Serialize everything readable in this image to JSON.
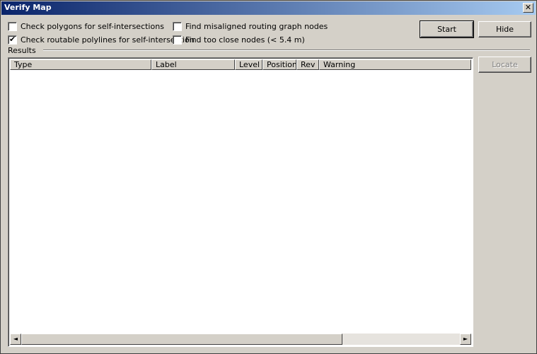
{
  "window": {
    "title": "Verify Map"
  },
  "close_icon": "✕",
  "options": {
    "check_polygons": {
      "label": "Check polygons for self-intersections",
      "checked": false
    },
    "check_polylines": {
      "label": "Check routable polylines for self-intersection",
      "checked": true
    },
    "find_misaligned": {
      "label": "Find misaligned routing graph nodes",
      "checked": false
    },
    "find_close_nodes": {
      "label": "Find too close nodes (< 5.4 m)",
      "checked": false
    }
  },
  "buttons": {
    "start": "Start",
    "hide": "Hide",
    "locate": "Locate"
  },
  "results": {
    "label": "Results",
    "columns": [
      "Type",
      "Label",
      "Level",
      "Position",
      "Rev",
      "Warning"
    ]
  },
  "scroll_icons": {
    "left": "◄",
    "right": "►"
  }
}
